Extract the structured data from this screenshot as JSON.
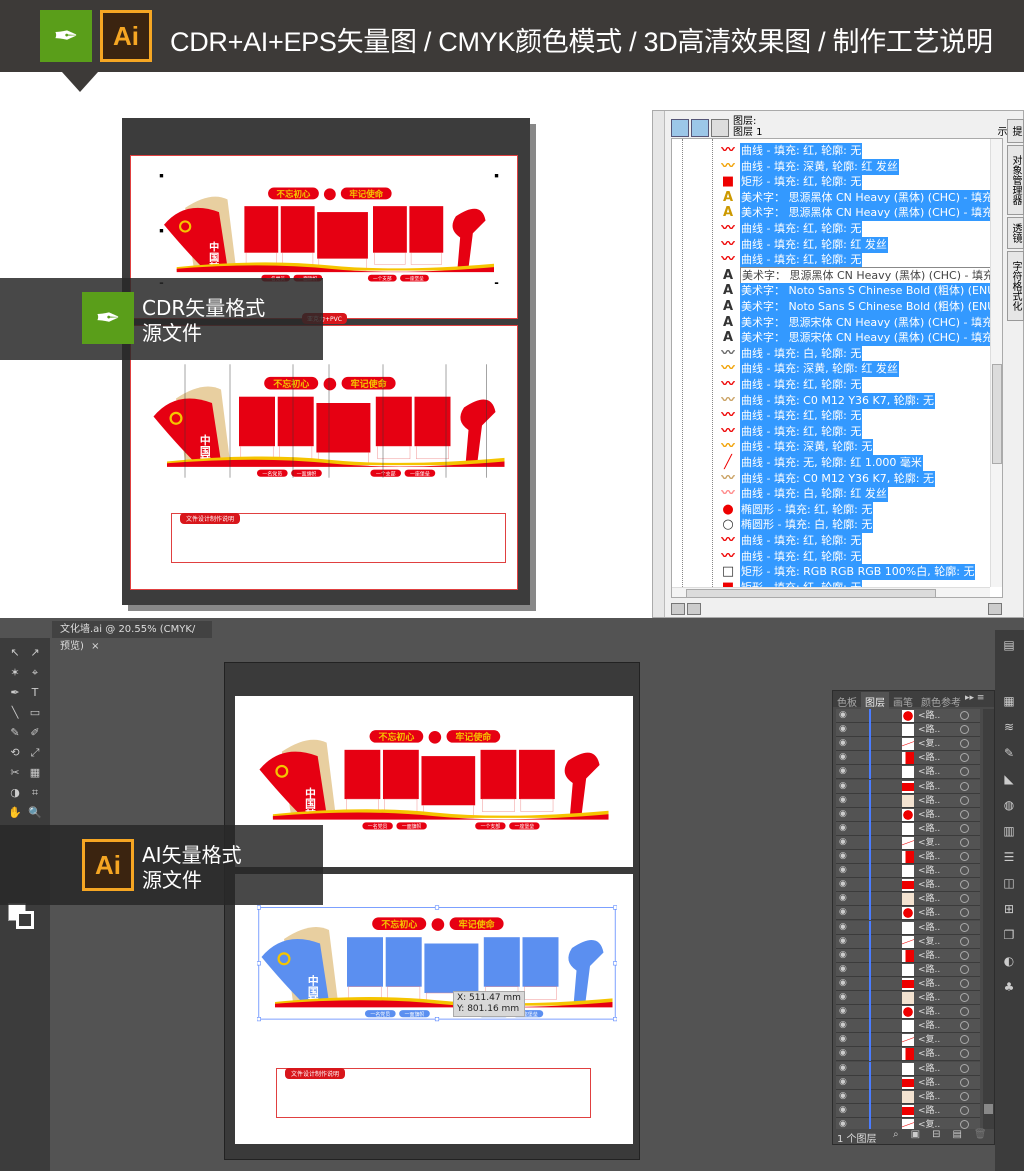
{
  "header": {
    "title": "CDR+AI+EPS矢量图  /  CMYK颜色模式  /  3D高清效果图  /  制作工艺说明",
    "ai_logo": "Ai"
  },
  "colors": {
    "header_bg": "#3d3a38",
    "party_red": "#e60012",
    "gold": "#f5c400",
    "beige": "#e8cfa0",
    "selection_blue": "#3399ff",
    "ai_bg": "#535353"
  },
  "artwork": {
    "slogan_left": "不忘初心",
    "slogan_right": "牢记使命",
    "dream": "中国梦",
    "pills": [
      "一名党员",
      "一面旗帜",
      "一个支部",
      "一座堡垒"
    ],
    "note_title": "文件设计制作说明",
    "cdr_top_tag": "亚克力+PVC"
  },
  "cdr_overlay": {
    "line1": "CDR矢量格式",
    "line2": "源文件"
  },
  "ai_overlay": {
    "line1": "AI矢量格式",
    "line2": "源文件"
  },
  "cdr_panel": {
    "layer_title": "图层:",
    "layer_name": "图层 1",
    "side_tabs": [
      "提示",
      "对象管理器",
      "透镜",
      "字符格式化"
    ],
    "items": [
      {
        "icon": "curve-red",
        "text": "曲线 - 填充: 红, 轮廓: 无"
      },
      {
        "icon": "curve-yellow",
        "text": "曲线 - 填充: 深黄, 轮廓: 红 发丝"
      },
      {
        "icon": "rect-red",
        "text": "矩形 - 填充: 红, 轮廓: 无"
      },
      {
        "icon": "text-yellow",
        "text": "美术字： 思源黑体 CN Heavy (黑体) (CHC) - 填充: 深黄, 轮廓"
      },
      {
        "icon": "text-yellow",
        "text": "美术字： 思源黑体 CN Heavy (黑体) (CHC) - 填充: 深黄, 轮廓"
      },
      {
        "icon": "curve-red",
        "text": "曲线 - 填充: 红, 轮廓: 无"
      },
      {
        "icon": "curve-red",
        "text": "曲线 - 填充: 红, 轮廓: 红 发丝"
      },
      {
        "icon": "curve-red",
        "text": "曲线 - 填充: 红, 轮廓: 无"
      },
      {
        "icon": "text-white",
        "text": "美术字： 思源黑体 CN Heavy (黑体) (CHC) - 填充: 白, 轮廓: 无",
        "tooltip": true
      },
      {
        "icon": "text-white",
        "text": "美术字： Noto Sans S Chinese Bold (粗体) (ENU) - 填充: 白"
      },
      {
        "icon": "text-white",
        "text": "美术字： Noto Sans S Chinese Bold (粗体) (ENU) - 填充: 白"
      },
      {
        "icon": "text-white",
        "text": "美术字： 思源宋体 CN Heavy (黑体) (CHC) - 填充: 白, 轮廓:"
      },
      {
        "icon": "text-white",
        "text": "美术字： 思源宋体 CN Heavy (黑体) (CHC) - 填充: 白, 轮廓:"
      },
      {
        "icon": "curve-white",
        "text": "曲线 - 填充: 白, 轮廓: 无"
      },
      {
        "icon": "curve-yellow",
        "text": "曲线 - 填充: 深黄, 轮廓: 红 发丝"
      },
      {
        "icon": "curve-red",
        "text": "曲线 - 填充: 红, 轮廓: 无"
      },
      {
        "icon": "curve-beige",
        "text": "曲线 - 填充: C0 M12 Y36 K7, 轮廓: 无"
      },
      {
        "icon": "curve-red",
        "text": "曲线 - 填充: 红, 轮廓: 无"
      },
      {
        "icon": "curve-red",
        "text": "曲线 - 填充: 红, 轮廓: 无"
      },
      {
        "icon": "curve-yellow",
        "text": "曲线 - 填充: 深黄, 轮廓: 无"
      },
      {
        "icon": "line-red",
        "text": "曲线 - 填充: 无, 轮廓: 红  1.000 毫米"
      },
      {
        "icon": "curve-beige",
        "text": "曲线 - 填充: C0 M12 Y36 K7, 轮廓: 无"
      },
      {
        "icon": "curve-outline",
        "text": "曲线 - 填充: 白, 轮廓: 红 发丝"
      },
      {
        "icon": "ellipse-red",
        "text": "椭圆形 - 填充: 红, 轮廓: 无"
      },
      {
        "icon": "ellipse-white",
        "text": "椭圆形 - 填充: 白, 轮廓: 无"
      },
      {
        "icon": "curve-red",
        "text": "曲线 - 填充: 红, 轮廓: 无"
      },
      {
        "icon": "curve-red",
        "text": "曲线 - 填充: 红, 轮廓: 无"
      },
      {
        "icon": "rect-white",
        "text": "矩形 - 填充: RGB RGB RGB 100%白, 轮廓: 无"
      },
      {
        "icon": "rect-red",
        "text": "矩形 - 填充: 红, 轮廓: 无"
      }
    ]
  },
  "ai_window": {
    "doc_tab": "文化墙.ai @ 20.55% (CMYK/预览)",
    "tooltip_x": "X: 511.47 mm",
    "tooltip_y": "Y: 801.16 mm",
    "panel_tabs": [
      "色板",
      "图层",
      "画笔",
      "颜色参考"
    ],
    "active_tab": "图层",
    "layer_count": "1 个图层",
    "rows": [
      {
        "thumb": "circle",
        "name": "<路.."
      },
      {
        "thumb": "white",
        "name": "<路.."
      },
      {
        "thumb": "dots",
        "name": "<复.."
      },
      {
        "thumb": "redpart",
        "name": "<路.."
      },
      {
        "thumb": "white",
        "name": "<路.."
      },
      {
        "thumb": "red",
        "name": "<路.."
      },
      {
        "thumb": "beige",
        "name": "<路.."
      },
      {
        "thumb": "circle",
        "name": "<路.."
      },
      {
        "thumb": "white",
        "name": "<路.."
      },
      {
        "thumb": "dots",
        "name": "<复.."
      },
      {
        "thumb": "redpart",
        "name": "<路.."
      },
      {
        "thumb": "white",
        "name": "<路.."
      },
      {
        "thumb": "red",
        "name": "<路.."
      },
      {
        "thumb": "beige",
        "name": "<路.."
      },
      {
        "thumb": "circle",
        "name": "<路.."
      },
      {
        "thumb": "white",
        "name": "<路.."
      },
      {
        "thumb": "dots",
        "name": "<复.."
      },
      {
        "thumb": "redpart",
        "name": "<路.."
      },
      {
        "thumb": "white",
        "name": "<路.."
      },
      {
        "thumb": "red",
        "name": "<路.."
      },
      {
        "thumb": "beige",
        "name": "<路.."
      },
      {
        "thumb": "circle",
        "name": "<路.."
      },
      {
        "thumb": "white",
        "name": "<路.."
      },
      {
        "thumb": "dots",
        "name": "<复.."
      },
      {
        "thumb": "redpart",
        "name": "<路.."
      },
      {
        "thumb": "white",
        "name": "<路.."
      },
      {
        "thumb": "red",
        "name": "<路.."
      },
      {
        "thumb": "beige",
        "name": "<路.."
      },
      {
        "thumb": "red",
        "name": "<路.."
      },
      {
        "thumb": "dots",
        "name": "<复.."
      }
    ]
  }
}
